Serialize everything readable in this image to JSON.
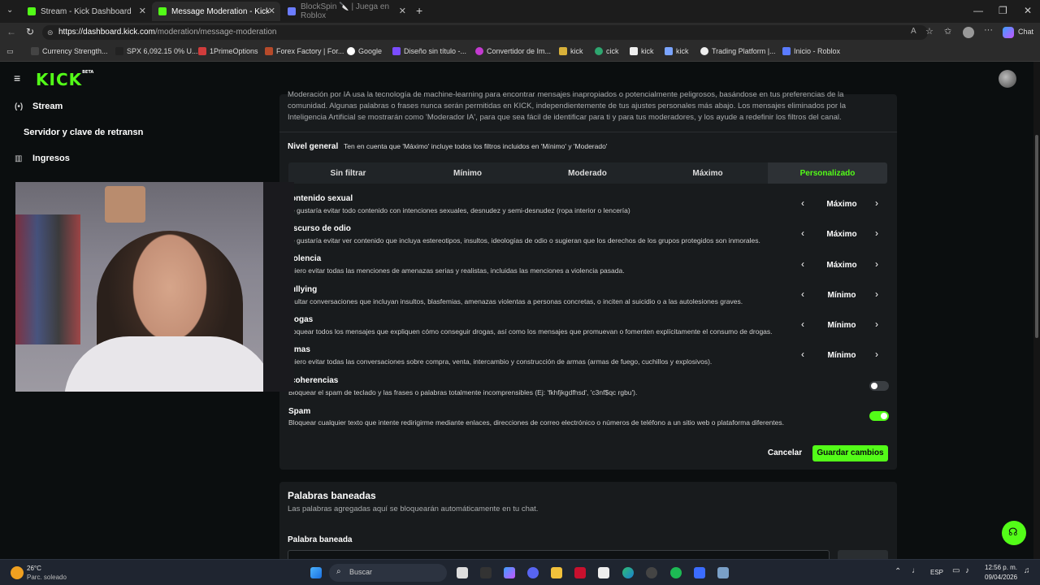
{
  "browser": {
    "tabs": [
      {
        "title": "Stream - Kick Dashboard"
      },
      {
        "title": "Message Moderation - Kick Dashb"
      },
      {
        "title": "BlockSpin 🔪 | Juega en Roblox"
      }
    ],
    "url_host": "https://dashboard.kick.com",
    "url_path": "/moderation/message-moderation",
    "chat_label": "Chat",
    "bookmarks": [
      {
        "label": "Currency Strength..."
      },
      {
        "label": "SPX 6,092.15 0% U..."
      },
      {
        "label": "1PrimeOptions"
      },
      {
        "label": "Forex Factory | For..."
      },
      {
        "label": "Google"
      },
      {
        "label": "Diseño sin título -..."
      },
      {
        "label": "Convertidor de Im..."
      },
      {
        "label": "kick"
      },
      {
        "label": "cick"
      },
      {
        "label": "kick"
      },
      {
        "label": "kick"
      },
      {
        "label": "Trading Platform |..."
      },
      {
        "label": "Inicio - Roblox"
      }
    ]
  },
  "app": {
    "logo": "KICK",
    "logo_badge": "BETA"
  },
  "sidebar": {
    "items": [
      {
        "label": "Stream",
        "icon": "broadcast-icon"
      },
      {
        "label": "Servidor y clave de retransn"
      },
      {
        "label": "Ingresos",
        "icon": "bar-chart-icon"
      }
    ]
  },
  "moderation": {
    "intro": "Moderación por IA usa la tecnología de machine-learning para encontrar mensajes inapropiados o potencialmente peligrosos, basándose en tus preferencias de la comunidad. Algunas palabras o frases nunca serán permitidas en KICK, independientemente de tus ajustes personales más abajo. Los mensajes eliminados por la Inteligencia Artificial se mostrarán como 'Moderador IA', para que sea fácil de identificar para ti y para tus moderadores, y los ayude a redefinir los filtros del canal.",
    "general_label": "Nivel general",
    "general_hint": "Ten en cuenta que 'Máximo' incluye todos los filtros incluidos en 'Mínimo' y 'Moderado'",
    "levels": [
      "Sin filtrar",
      "Mínimo",
      "Moderado",
      "Máximo",
      "Personalizado"
    ],
    "active_level": "Personalizado",
    "categories": [
      {
        "title": "ontenido sexual",
        "desc": "e gustaría evitar todo contenido con intenciones sexuales, desnudez y semi-desnudez (ropa interior o lencería)",
        "level": "Máximo"
      },
      {
        "title": "iscurso de odio",
        "desc": "e gustaría evitar ver contenido que incluya estereotipos, insultos, ideologías de odio o sugieran que los derechos de los grupos protegidos son inmorales.",
        "level": "Máximo"
      },
      {
        "title": "iolencia",
        "desc": "uiero evitar todas las menciones de amenazas serias y realistas, incluidas las menciones a violencia pasada.",
        "level": "Máximo"
      },
      {
        "title": "ullying",
        "desc": "cultar conversaciones que incluyan insultos, blasfemias, amenazas violentas a personas concretas, o inciten al suicidio o a las autolesiones graves.",
        "level": "Mínimo"
      },
      {
        "title": "rogas",
        "desc": "loquear todos los mensajes que expliquen cómo conseguir drogas, así como los mensajes que promuevan o fomenten explícitamente el consumo de drogas.",
        "level": "Mínimo"
      },
      {
        "title": "rmas",
        "desc": "uiero evitar todas las conversaciones sobre compra, venta, intercambio y construcción de armas (armas de fuego, cuchillos y explosivos).",
        "level": "Mínimo"
      }
    ],
    "toggles": [
      {
        "title": "coherencias",
        "desc": "Bloquear el spam de teclado y las frases o palabras totalmente incomprensibles (Ej: 'fkhfjkgdfhsd', 'c3nf$qc rgbu').",
        "on": false
      },
      {
        "title": "Spam",
        "desc": "Bloquear cualquier texto que intente redirigirme mediante enlaces, direcciones de correo electrónico o números de teléfono a un sitio web o plataforma diferentes.",
        "on": true
      }
    ],
    "cancel_label": "Cancelar",
    "save_label": "Guardar cambios"
  },
  "banned_words": {
    "title": "Palabras baneadas",
    "desc": "Las palabras agregadas aquí se bloquearán automáticamente en tu chat.",
    "field_label": "Palabra baneada"
  },
  "taskbar": {
    "weather_temp": "26°C",
    "weather_desc": "Parc. soleado",
    "search_label": "Buscar",
    "language": "ESP",
    "time": "12:56 p. m.",
    "date": "09/04/2026"
  },
  "colors": {
    "accent": "#53fc18",
    "panel": "#181b1d",
    "background": "#0b0e0f"
  }
}
